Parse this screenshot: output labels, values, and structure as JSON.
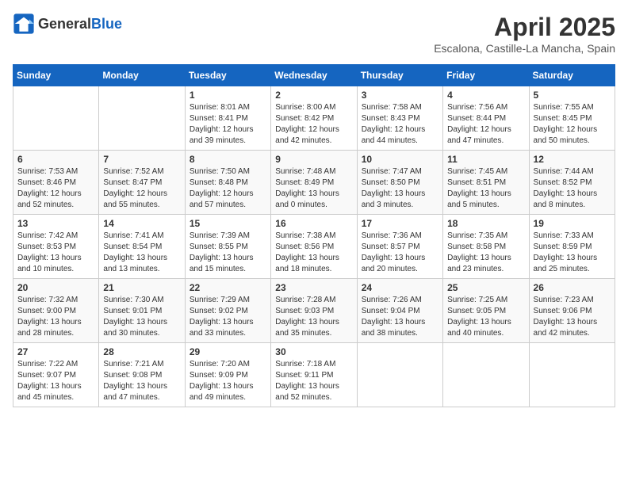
{
  "header": {
    "logo_general": "General",
    "logo_blue": "Blue",
    "month_title": "April 2025",
    "location": "Escalona, Castille-La Mancha, Spain"
  },
  "weekdays": [
    "Sunday",
    "Monday",
    "Tuesday",
    "Wednesday",
    "Thursday",
    "Friday",
    "Saturday"
  ],
  "weeks": [
    [
      {
        "day": "",
        "info": ""
      },
      {
        "day": "",
        "info": ""
      },
      {
        "day": "1",
        "info": "Sunrise: 8:01 AM\nSunset: 8:41 PM\nDaylight: 12 hours and 39 minutes."
      },
      {
        "day": "2",
        "info": "Sunrise: 8:00 AM\nSunset: 8:42 PM\nDaylight: 12 hours and 42 minutes."
      },
      {
        "day": "3",
        "info": "Sunrise: 7:58 AM\nSunset: 8:43 PM\nDaylight: 12 hours and 44 minutes."
      },
      {
        "day": "4",
        "info": "Sunrise: 7:56 AM\nSunset: 8:44 PM\nDaylight: 12 hours and 47 minutes."
      },
      {
        "day": "5",
        "info": "Sunrise: 7:55 AM\nSunset: 8:45 PM\nDaylight: 12 hours and 50 minutes."
      }
    ],
    [
      {
        "day": "6",
        "info": "Sunrise: 7:53 AM\nSunset: 8:46 PM\nDaylight: 12 hours and 52 minutes."
      },
      {
        "day": "7",
        "info": "Sunrise: 7:52 AM\nSunset: 8:47 PM\nDaylight: 12 hours and 55 minutes."
      },
      {
        "day": "8",
        "info": "Sunrise: 7:50 AM\nSunset: 8:48 PM\nDaylight: 12 hours and 57 minutes."
      },
      {
        "day": "9",
        "info": "Sunrise: 7:48 AM\nSunset: 8:49 PM\nDaylight: 13 hours and 0 minutes."
      },
      {
        "day": "10",
        "info": "Sunrise: 7:47 AM\nSunset: 8:50 PM\nDaylight: 13 hours and 3 minutes."
      },
      {
        "day": "11",
        "info": "Sunrise: 7:45 AM\nSunset: 8:51 PM\nDaylight: 13 hours and 5 minutes."
      },
      {
        "day": "12",
        "info": "Sunrise: 7:44 AM\nSunset: 8:52 PM\nDaylight: 13 hours and 8 minutes."
      }
    ],
    [
      {
        "day": "13",
        "info": "Sunrise: 7:42 AM\nSunset: 8:53 PM\nDaylight: 13 hours and 10 minutes."
      },
      {
        "day": "14",
        "info": "Sunrise: 7:41 AM\nSunset: 8:54 PM\nDaylight: 13 hours and 13 minutes."
      },
      {
        "day": "15",
        "info": "Sunrise: 7:39 AM\nSunset: 8:55 PM\nDaylight: 13 hours and 15 minutes."
      },
      {
        "day": "16",
        "info": "Sunrise: 7:38 AM\nSunset: 8:56 PM\nDaylight: 13 hours and 18 minutes."
      },
      {
        "day": "17",
        "info": "Sunrise: 7:36 AM\nSunset: 8:57 PM\nDaylight: 13 hours and 20 minutes."
      },
      {
        "day": "18",
        "info": "Sunrise: 7:35 AM\nSunset: 8:58 PM\nDaylight: 13 hours and 23 minutes."
      },
      {
        "day": "19",
        "info": "Sunrise: 7:33 AM\nSunset: 8:59 PM\nDaylight: 13 hours and 25 minutes."
      }
    ],
    [
      {
        "day": "20",
        "info": "Sunrise: 7:32 AM\nSunset: 9:00 PM\nDaylight: 13 hours and 28 minutes."
      },
      {
        "day": "21",
        "info": "Sunrise: 7:30 AM\nSunset: 9:01 PM\nDaylight: 13 hours and 30 minutes."
      },
      {
        "day": "22",
        "info": "Sunrise: 7:29 AM\nSunset: 9:02 PM\nDaylight: 13 hours and 33 minutes."
      },
      {
        "day": "23",
        "info": "Sunrise: 7:28 AM\nSunset: 9:03 PM\nDaylight: 13 hours and 35 minutes."
      },
      {
        "day": "24",
        "info": "Sunrise: 7:26 AM\nSunset: 9:04 PM\nDaylight: 13 hours and 38 minutes."
      },
      {
        "day": "25",
        "info": "Sunrise: 7:25 AM\nSunset: 9:05 PM\nDaylight: 13 hours and 40 minutes."
      },
      {
        "day": "26",
        "info": "Sunrise: 7:23 AM\nSunset: 9:06 PM\nDaylight: 13 hours and 42 minutes."
      }
    ],
    [
      {
        "day": "27",
        "info": "Sunrise: 7:22 AM\nSunset: 9:07 PM\nDaylight: 13 hours and 45 minutes."
      },
      {
        "day": "28",
        "info": "Sunrise: 7:21 AM\nSunset: 9:08 PM\nDaylight: 13 hours and 47 minutes."
      },
      {
        "day": "29",
        "info": "Sunrise: 7:20 AM\nSunset: 9:09 PM\nDaylight: 13 hours and 49 minutes."
      },
      {
        "day": "30",
        "info": "Sunrise: 7:18 AM\nSunset: 9:11 PM\nDaylight: 13 hours and 52 minutes."
      },
      {
        "day": "",
        "info": ""
      },
      {
        "day": "",
        "info": ""
      },
      {
        "day": "",
        "info": ""
      }
    ]
  ]
}
